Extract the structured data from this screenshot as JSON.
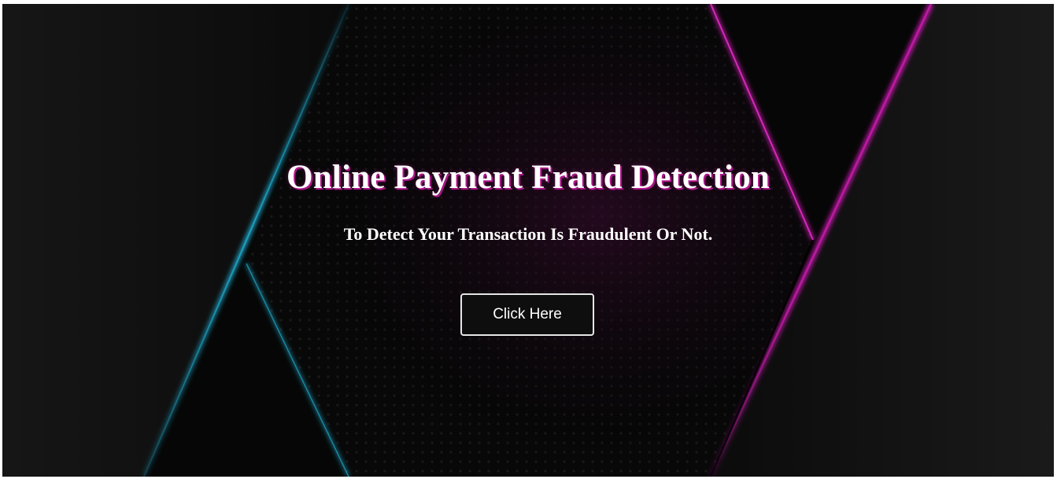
{
  "hero": {
    "title": "Online Payment Fraud Detection",
    "subtitle": "To Detect Your Transaction Is Fraudulent Or Not.",
    "button_label": "Click Here"
  },
  "theme": {
    "background": "#050505",
    "accent_cyan": "#1fa6c8",
    "accent_magenta": "#c21aa8",
    "title_shadow": "#b0168c"
  }
}
